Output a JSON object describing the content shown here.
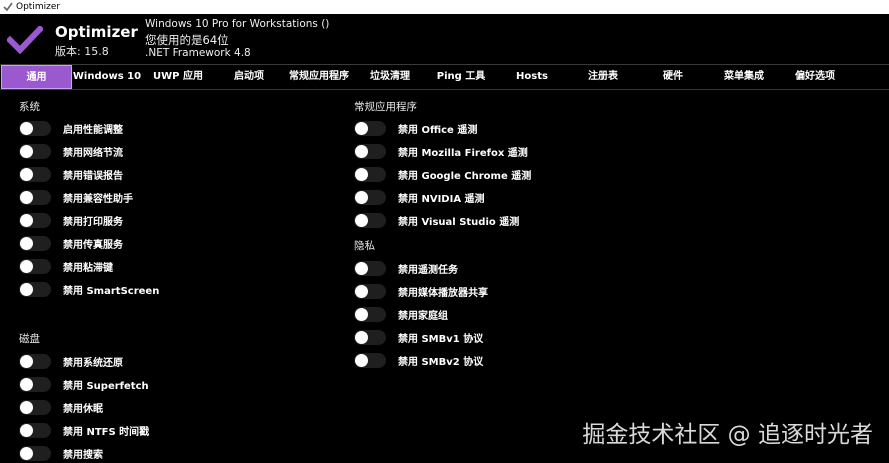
{
  "window": {
    "title": "Optimizer"
  },
  "header": {
    "app_name": "Optimizer",
    "version": "版本: 15.8",
    "os": "Windows 10 Pro for Workstations ()",
    "bits": "您使用的是64位",
    "framework": ".NET Framework 4.8",
    "accent": "#9b59d0"
  },
  "tabs": [
    {
      "label": "通用"
    },
    {
      "label": "Windows 10"
    },
    {
      "label": "UWP 应用"
    },
    {
      "label": "启动项"
    },
    {
      "label": "常规应用程序"
    },
    {
      "label": "垃圾清理"
    },
    {
      "label": "Ping 工具"
    },
    {
      "label": "Hosts"
    },
    {
      "label": "注册表"
    },
    {
      "label": "硬件"
    },
    {
      "label": "菜单集成"
    },
    {
      "label": "偏好选项"
    }
  ],
  "sections": {
    "system": {
      "title": "系统",
      "items": [
        {
          "label": "启用性能调整"
        },
        {
          "label": "禁用网络节流"
        },
        {
          "label": "禁用错误报告"
        },
        {
          "label": "禁用兼容性助手"
        },
        {
          "label": "禁用打印服务"
        },
        {
          "label": "禁用传真服务"
        },
        {
          "label": "禁用粘滞键"
        },
        {
          "label": "禁用 SmartScreen"
        }
      ]
    },
    "disk": {
      "title": "磁盘",
      "items": [
        {
          "label": "禁用系统还原"
        },
        {
          "label": "禁用 Superfetch"
        },
        {
          "label": "禁用休眠"
        },
        {
          "label": "禁用 NTFS 时间戳"
        },
        {
          "label": "禁用搜索"
        }
      ]
    },
    "apps": {
      "title": "常规应用程序",
      "items": [
        {
          "label": "禁用 Office 遥测"
        },
        {
          "label": "禁用 Mozilla Firefox 遥测"
        },
        {
          "label": "禁用 Google Chrome 遥测"
        },
        {
          "label": "禁用 NVIDIA 遥测"
        },
        {
          "label": "禁用 Visual Studio 遥测"
        }
      ]
    },
    "privacy": {
      "title": "隐私",
      "items": [
        {
          "label": "禁用遥测任务"
        },
        {
          "label": "禁用媒体播放器共享"
        },
        {
          "label": "禁用家庭组"
        },
        {
          "label": "禁用 SMBv1 协议"
        },
        {
          "label": "禁用 SMBv2 协议"
        }
      ]
    }
  },
  "watermark": "掘金技术社区 @ 追逐时光者"
}
